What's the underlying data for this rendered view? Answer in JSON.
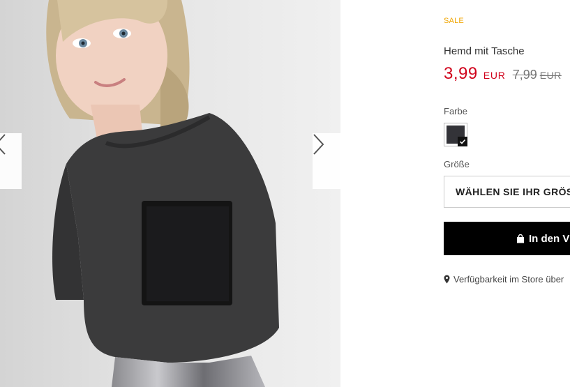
{
  "product": {
    "badge": "SALE",
    "title": "Hemd mit Tasche",
    "price_now": "3,99",
    "currency_now": "EUR",
    "price_old": "7,99",
    "currency_old": "EUR",
    "sale_color": "#f0a500",
    "price_color": "#d0021b"
  },
  "color_section": {
    "label": "Farbe",
    "selected_swatch": "#333338"
  },
  "size_section": {
    "label": "Größe",
    "select_text": "WÄHLEN SIE IHR GRÖS"
  },
  "cart": {
    "button_label": "In den V",
    "icon": "shopping-bag-icon"
  },
  "store": {
    "link_text": "Verfügbarkeit im Store über",
    "icon": "map-pin-icon"
  },
  "gallery": {
    "prev_icon": "chevron-left-icon",
    "next_icon": "chevron-right-icon"
  }
}
